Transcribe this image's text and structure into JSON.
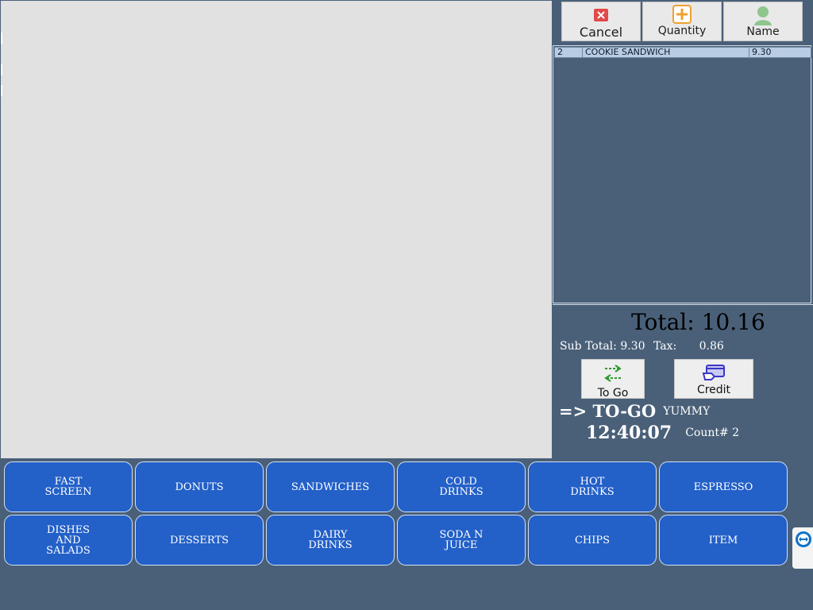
{
  "toolbar": {
    "cancel_label": "Cancel",
    "quantity_label": "Quantity",
    "name_label": "Name"
  },
  "order": {
    "items": [
      {
        "qty": "2",
        "name": "COOKIE SANDWICH",
        "price": "9.30"
      }
    ]
  },
  "totals": {
    "total_label": "Total:",
    "total_value": "10.16",
    "subtotal_label": "Sub Total:",
    "subtotal_value": "9.30",
    "tax_label": "Tax:",
    "tax_value": "0.86"
  },
  "actions": {
    "togo_label": "To Go",
    "credit_label": "Credit"
  },
  "status": {
    "mode": "=> TO-GO",
    "user": "YUMMY",
    "time": "12:40:07",
    "count": "Count# 2"
  },
  "categories": [
    "FAST\nSCREEN",
    "DONUTS",
    "SANDWICHES",
    "COLD\nDRINKS",
    "HOT\nDRINKS",
    "ESPRESSO",
    "DISHES\nAND\nSALADS",
    "DESSERTS",
    "DAIRY\nDRINKS",
    "SODA N\nJUICE",
    "CHIPS",
    "ITEM"
  ],
  "colors": {
    "background": "#4a6079",
    "canvas": "#e1e1e1",
    "category_button": "#2360c8",
    "selected_row": "#b8cde4"
  },
  "icons": {
    "cancel": "close-icon",
    "quantity": "plus-icon",
    "name": "person-icon",
    "togo": "swap-arrows-icon",
    "credit": "credit-card-icon",
    "side_tab": "teamviewer-icon"
  }
}
